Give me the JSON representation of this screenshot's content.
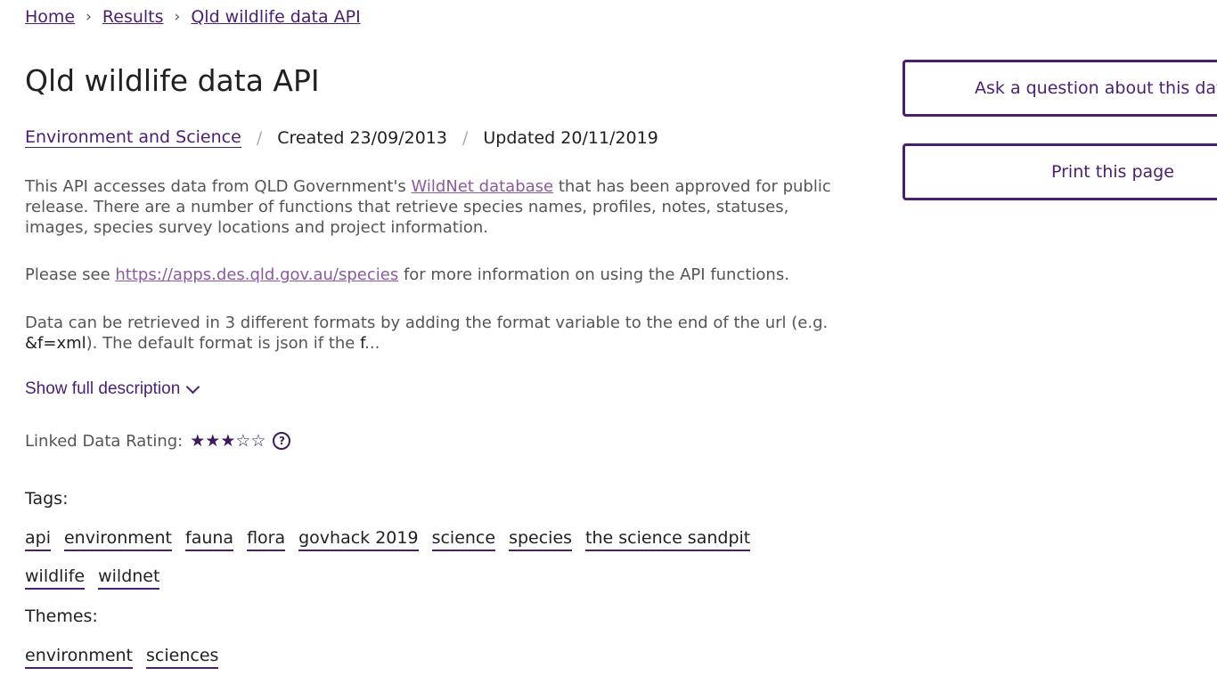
{
  "breadcrumb": {
    "home": "Home",
    "results": "Results",
    "current": "Qld wildlife data API",
    "separator": "›"
  },
  "page_title": "Qld wildlife data API",
  "meta": {
    "organisation": "Environment and Science",
    "created": "Created 23/09/2013",
    "updated": "Updated 20/11/2019",
    "separator": "/"
  },
  "description": {
    "p1_before": "This API accesses data from QLD Government's ",
    "p1_link": "WildNet database",
    "p1_after": " that has been approved for public release. There are a number of functions that retrieve species names, profiles, notes, statuses, images, species survey locations and project information.",
    "p2_before": "Please see ",
    "p2_link": "https://apps.des.qld.gov.au/species",
    "p2_after": " for more information on using the API functions.",
    "p3_before": "Data can be retrieved in 3 different formats by adding the format variable to the end of the url (e.g. ",
    "p3_code": "&f=xml",
    "p3_mid": "). The default format is json if the ",
    "p3_end": "f",
    "p3_ellipsis": "..."
  },
  "show_full": "Show full description",
  "rating": {
    "label": "Linked Data Rating:",
    "value": 3,
    "max": 5,
    "stars_text": "★★★☆☆",
    "help_icon": "?"
  },
  "tags": {
    "label": "Tags:",
    "items": [
      "api",
      "environment",
      "fauna",
      "flora",
      "govhack 2019",
      "science",
      "species",
      "the science sandpit",
      "wildlife",
      "wildnet"
    ]
  },
  "themes": {
    "label": "Themes:",
    "items": [
      "environment",
      "sciences"
    ]
  },
  "actions": {
    "ask": "Ask a question about this data",
    "print": "Print this page"
  },
  "colors": {
    "brand_purple": "#4b1f6f",
    "link_visited": "#8b5a9e",
    "star": "#3c1a5b"
  }
}
